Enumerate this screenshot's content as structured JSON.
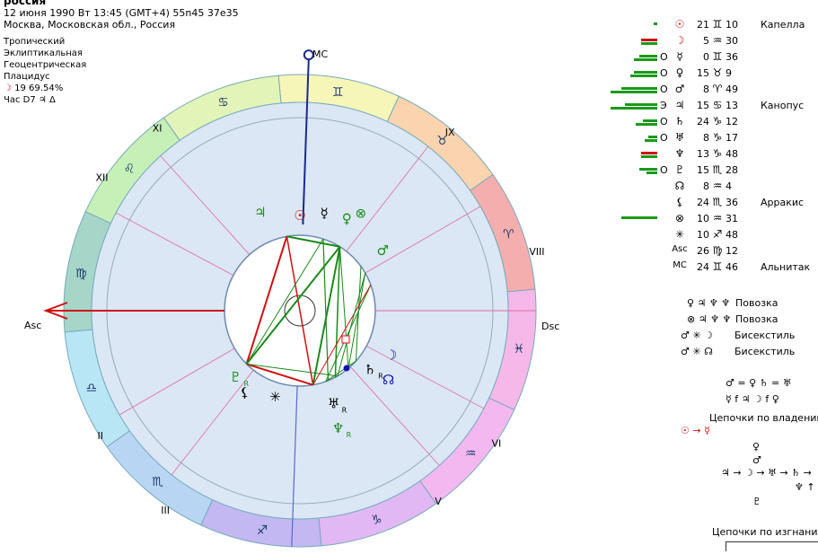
{
  "header": {
    "title": "россия",
    "line1": "12 июня 1990  Вт  13:45 (GMT+4) 55n45  37e35",
    "line2": "Москва, Московская обл., Россия"
  },
  "settings": [
    "Тропический",
    "Эклиптикальная",
    "Геоцентрическая",
    "Плацидус"
  ],
  "moon_phase": {
    "glyph": "☽",
    "text": "19 69.54%"
  },
  "hour_lord": "Час D7 ♃ Δ",
  "chart": {
    "house_numbers": [
      "XI",
      "IX",
      "XII",
      "VIII",
      "II",
      "VI",
      "III",
      "V"
    ],
    "labels": {
      "mc": "MC",
      "asc": "Asc",
      "dsc": "Dsc"
    },
    "signs": [
      {
        "glyph": "♊",
        "color": "#f6f6b8"
      },
      {
        "glyph": "♉",
        "color": "#f9d4ae"
      },
      {
        "glyph": "♈",
        "color": "#f4aeae"
      },
      {
        "glyph": "♓",
        "color": "#f6b8e8"
      },
      {
        "glyph": "♒",
        "color": "#f4b8f0"
      },
      {
        "glyph": "♑",
        "color": "#e2b8f4"
      },
      {
        "glyph": "♐",
        "color": "#c3b8f2"
      },
      {
        "glyph": "♏",
        "color": "#b8d6f4"
      },
      {
        "glyph": "♎",
        "color": "#b8e6f4"
      },
      {
        "glyph": "♍",
        "color": "#a6d6c8"
      },
      {
        "glyph": "♌",
        "color": "#c6f0b8"
      },
      {
        "glyph": "♋",
        "color": "#e2f4b8"
      }
    ],
    "planets": [
      {
        "glyph": "♃",
        "color": "#1a8a1a",
        "sub": ""
      },
      {
        "glyph": "☉",
        "color": "#d01010",
        "sub": ""
      },
      {
        "glyph": "☿",
        "color": "#000000",
        "sub": ""
      },
      {
        "glyph": "♀",
        "color": "#1a8a1a",
        "sub": ""
      },
      {
        "glyph": "⊗",
        "color": "#1a8a1a",
        "sub": ""
      },
      {
        "glyph": "♂",
        "color": "#1a8a1a",
        "sub": ""
      },
      {
        "glyph": "☽",
        "color": "#1010b0",
        "sub": ""
      },
      {
        "glyph": "☊",
        "color": "#1010b0",
        "sub": ""
      },
      {
        "glyph": "♄",
        "color": "#000000",
        "sub": "R"
      },
      {
        "glyph": "♅",
        "color": "#000000",
        "sub": "R"
      },
      {
        "glyph": "♆",
        "color": "#1a8a1a",
        "sub": "R"
      },
      {
        "glyph": "✳",
        "color": "#000000",
        "sub": ""
      },
      {
        "glyph": "⚸",
        "color": "#000000",
        "sub": ""
      },
      {
        "glyph": "♇",
        "color": "#1a8a1a",
        "sub": "R"
      }
    ]
  },
  "planet_table": [
    {
      "bars": [
        4
      ],
      "bar_colors": [
        "#1a9a1a"
      ],
      "ret": "",
      "glyph": "☉",
      "glyph_color": "#d01010",
      "deg": "21",
      "sign": "♊",
      "min": "10",
      "star": "Капелла"
    },
    {
      "bars": [
        18,
        18
      ],
      "bar_colors": [
        "#d01010",
        "#1a9a1a"
      ],
      "ret": "",
      "glyph": "☽",
      "glyph_color": "#d01010",
      "deg": "5",
      "sign": "♒",
      "min": "30",
      "star": ""
    },
    {
      "bars": [
        20,
        26
      ],
      "bar_colors": [
        "#1a9a1a",
        "#1a9a1a"
      ],
      "ret": "O",
      "glyph": "☿",
      "glyph_color": "#000000",
      "deg": "0",
      "sign": "♊",
      "min": "36",
      "star": ""
    },
    {
      "bars": [
        26,
        30
      ],
      "bar_colors": [
        "#1a9a1a",
        "#1a9a1a"
      ],
      "ret": "O",
      "glyph": "♀",
      "glyph_color": "#000000",
      "deg": "15",
      "sign": "♉",
      "min": "9",
      "star": ""
    },
    {
      "bars": [
        40,
        52
      ],
      "bar_colors": [
        "#1a9a1a",
        "#1a9a1a"
      ],
      "ret": "O",
      "glyph": "♂",
      "glyph_color": "#000000",
      "deg": "8",
      "sign": "♈",
      "min": "49",
      "star": ""
    },
    {
      "bars": [
        36,
        52
      ],
      "bar_colors": [
        "#1a9a1a",
        "#1a9a1a"
      ],
      "ret": "Э",
      "glyph": "♃",
      "glyph_color": "#000000",
      "deg": "15",
      "sign": "♋",
      "min": "13",
      "star": "Канопус"
    },
    {
      "bars": [
        16,
        24
      ],
      "bar_colors": [
        "#1a9a1a",
        "#1a9a1a"
      ],
      "ret": "O",
      "glyph": "♄",
      "glyph_color": "#000000",
      "deg": "24",
      "sign": "♑",
      "min": "12",
      "star": ""
    },
    {
      "bars": [
        10,
        14
      ],
      "bar_colors": [
        "#1a9a1a",
        "#1a9a1a"
      ],
      "ret": "O",
      "glyph": "♅",
      "glyph_color": "#000000",
      "deg": "8",
      "sign": "♑",
      "min": "17",
      "star": ""
    },
    {
      "bars": [
        18,
        18
      ],
      "bar_colors": [
        "#d01010",
        "#1a9a1a"
      ],
      "ret": "",
      "glyph": "♆",
      "glyph_color": "#000000",
      "deg": "13",
      "sign": "♑",
      "min": "48",
      "star": ""
    },
    {
      "bars": [
        20,
        12
      ],
      "bar_colors": [
        "#1a9a1a",
        "#1a9a1a"
      ],
      "ret": "O",
      "glyph": "♇",
      "glyph_color": "#000000",
      "deg": "15",
      "sign": "♏",
      "min": "28",
      "star": ""
    },
    {
      "bars": [],
      "bar_colors": [],
      "ret": "",
      "glyph": "☊",
      "glyph_color": "#000000",
      "deg": "8",
      "sign": "♒",
      "min": "4",
      "star": ""
    },
    {
      "bars": [],
      "bar_colors": [],
      "ret": "",
      "glyph": "⚸",
      "glyph_color": "#000000",
      "deg": "24",
      "sign": "♏",
      "min": "36",
      "star": "Арракис"
    },
    {
      "bars": [
        40
      ],
      "bar_colors": [
        "#1a9a1a"
      ],
      "ret": "",
      "glyph": "⊗",
      "glyph_color": "#000000",
      "deg": "10",
      "sign": "♒",
      "min": "31",
      "star": ""
    },
    {
      "bars": [],
      "bar_colors": [],
      "ret": "",
      "glyph": "✳",
      "glyph_color": "#000000",
      "deg": "10",
      "sign": "♐",
      "min": "48",
      "star": ""
    },
    {
      "bars": [],
      "bar_colors": [],
      "ret": "",
      "glyph": "Asc",
      "glyph_color": "#000000",
      "deg": "26",
      "sign": "♍",
      "min": "12",
      "star": ""
    },
    {
      "bars": [],
      "bar_colors": [],
      "ret": "",
      "glyph": "MC",
      "glyph_color": "#000000",
      "deg": "24",
      "sign": "♊",
      "min": "46",
      "star": "Альнитак"
    }
  ],
  "configurations": [
    {
      "glyphs": "♀ ♃ ♆ ♆",
      "name": "Повозка"
    },
    {
      "glyphs": "⊗ ♃ ♆ ♆",
      "name": "Повозка"
    },
    {
      "glyphs": "♂ ✳ ☽",
      "name": "Бисекстиль"
    },
    {
      "glyphs": "♂ ✳ ☊",
      "name": "Бисекстиль"
    }
  ],
  "receptions": [
    "♂ = ♀ ♄ = ♅",
    "☿ f ♃ ☽ f ♀"
  ],
  "dispositor_title": "Цепочки по владению",
  "dispositor_chains": [
    "☉ → ☿",
    "♀",
    "♂",
    "♃ → ☽ → ♅ → ♄ →",
    "♆ ↑",
    "♇"
  ],
  "exile_title": "Цепочки по изгнанию"
}
